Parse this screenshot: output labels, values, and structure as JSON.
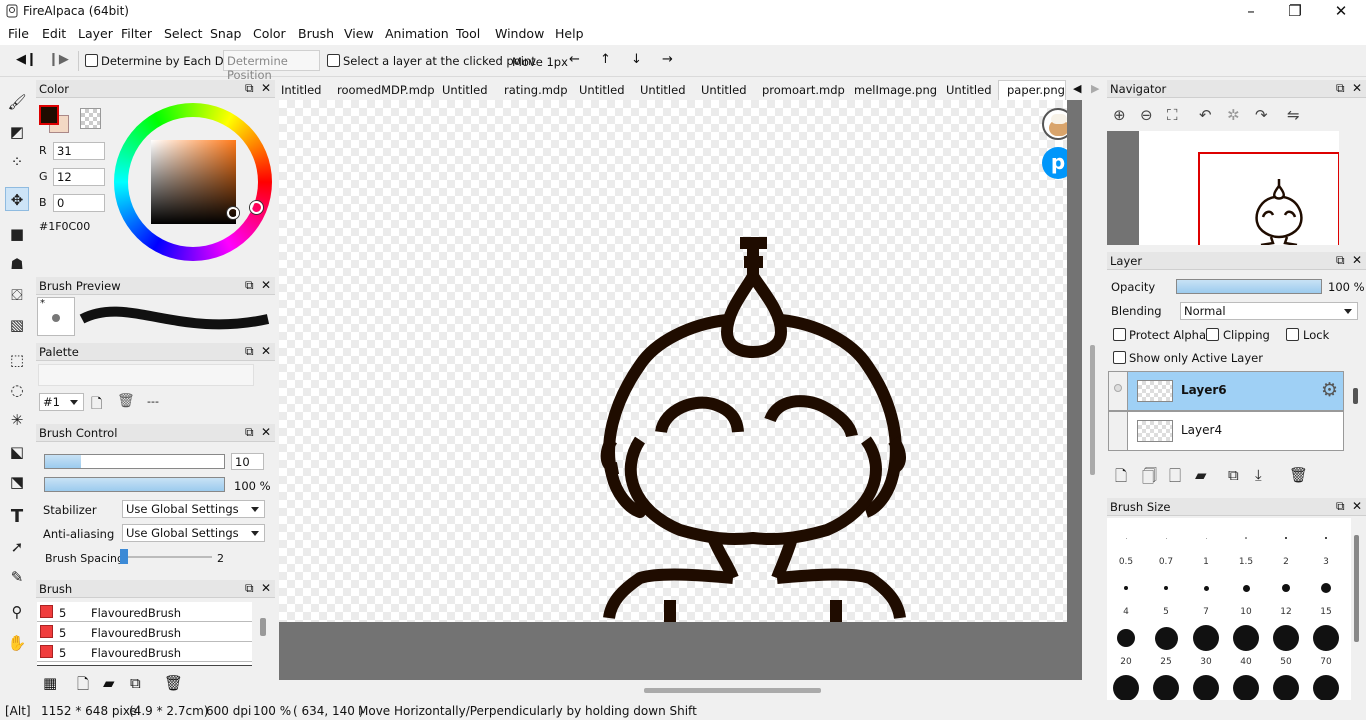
{
  "window": {
    "title": "FireAlpaca (64bit)"
  },
  "menu": [
    "File",
    "Edit",
    "Layer",
    "Filter",
    "Select",
    "Snap",
    "Color",
    "Brush",
    "View",
    "Animation",
    "Tool",
    "Window",
    "Help"
  ],
  "options": {
    "determine_each_drag": "Determine by Each Drag",
    "determine_position": "Determine Position",
    "select_layer_clicked": "Select a layer at the clicked point",
    "move_label": "Move 1px"
  },
  "color_panel": {
    "title": "Color",
    "r_label": "R",
    "r_value": "31",
    "g_label": "G",
    "g_value": "12",
    "b_label": "B",
    "b_value": "0",
    "hex": "#1F0C00",
    "primary_color": "#1f0c00"
  },
  "brush_preview": {
    "title": "Brush Preview",
    "marker": "*"
  },
  "palette": {
    "title": "Palette",
    "selected": "#1",
    "empty": "---"
  },
  "brush_control": {
    "title": "Brush Control",
    "size_value": "10",
    "size_fill": 0.2,
    "opacity_value": "100 %",
    "opacity_fill": 1.0,
    "stabilizer_label": "Stabilizer",
    "stabilizer_value": "Use Global Settings",
    "aa_label": "Anti-aliasing",
    "aa_value": "Use Global Settings",
    "spacing_label": "Brush Spacing",
    "spacing_value": "2"
  },
  "brush_list": {
    "title": "Brush",
    "items": [
      {
        "size": "5",
        "name": "FlavouredBrush"
      },
      {
        "size": "5",
        "name": "FlavouredBrush"
      },
      {
        "size": "5",
        "name": "FlavouredBrush"
      }
    ]
  },
  "tabs": [
    "Intitled",
    "roomedMDP.mdp",
    "Untitled",
    "rating.mdp",
    "Untitled",
    "Untitled",
    "Untitled",
    "promoart.mdp",
    "melImage.png",
    "Untitled",
    "paper.png"
  ],
  "active_tab_index": 10,
  "navigator": {
    "title": "Navigator"
  },
  "layer_panel": {
    "title": "Layer",
    "opacity_label": "Opacity",
    "opacity_value": "100 %",
    "opacity_fill": 1.0,
    "blending_label": "Blending",
    "blending_value": "Normal",
    "protect_alpha": "Protect Alpha",
    "clipping": "Clipping",
    "lock": "Lock",
    "show_only_active": "Show only Active Layer",
    "layers": [
      {
        "name": "Layer6",
        "active": true
      },
      {
        "name": "Layer4",
        "active": false
      }
    ]
  },
  "brush_size": {
    "title": "Brush Size",
    "sizes": [
      "0.5",
      "0.7",
      "1",
      "1.5",
      "2",
      "3",
      "4",
      "5",
      "7",
      "10",
      "12",
      "15",
      "20",
      "25",
      "30",
      "40",
      "50",
      "70",
      "",
      "",
      "",
      "",
      "",
      ""
    ]
  },
  "status": {
    "modifier": "[Alt]",
    "dimensions": "1152 * 648 pixel",
    "physical": "(4.9 * 2.7cm)",
    "dpi": "600 dpi",
    "zoom": "100 %",
    "coords": "( 634, 140 )",
    "hint": "Move Horizontally/Perpendicularly by holding down Shift"
  }
}
